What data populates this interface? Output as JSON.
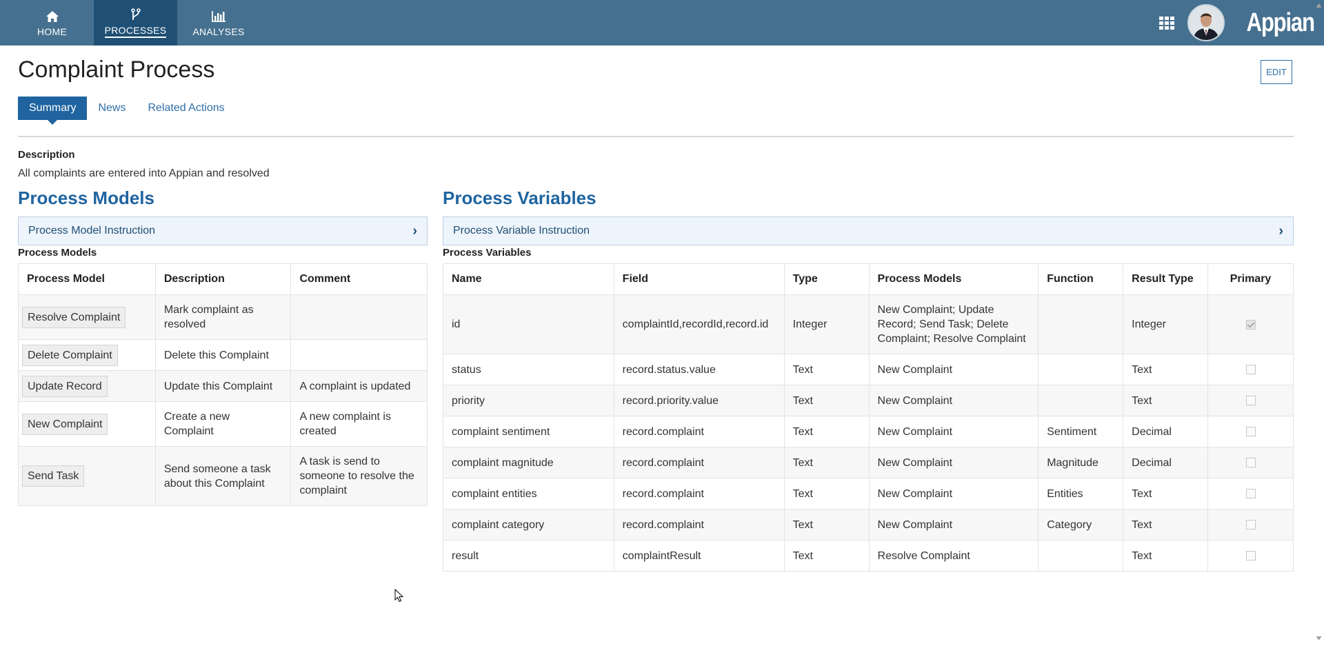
{
  "nav": {
    "home": {
      "label": "HOME",
      "icon": "home-icon"
    },
    "processes": {
      "label": "PROCESSES",
      "icon": "fork-icon"
    },
    "analyses": {
      "label": "ANALYSES",
      "icon": "bar-chart-icon"
    },
    "brand": "Appian"
  },
  "page": {
    "title": "Complaint Process",
    "edit_label": "EDIT",
    "tabs": [
      {
        "label": "Summary",
        "active": true
      },
      {
        "label": "News",
        "active": false
      },
      {
        "label": "Related Actions",
        "active": false
      }
    ],
    "description_label": "Description",
    "description_text": "All complaints are entered into Appian and resolved"
  },
  "process_models": {
    "heading": "Process Models",
    "instruction": "Process Model Instruction",
    "sub_label": "Process Models",
    "columns": [
      "Process Model",
      "Description",
      "Comment"
    ],
    "rows": [
      {
        "name": "Resolve Complaint",
        "description": "Mark complaint as resolved",
        "comment": ""
      },
      {
        "name": "Delete Complaint",
        "description": "Delete this Complaint",
        "comment": ""
      },
      {
        "name": "Update Record",
        "description": "Update this Complaint",
        "comment": "A complaint is updated"
      },
      {
        "name": "New Complaint",
        "description": "Create a new Complaint",
        "comment": "A new complaint is created"
      },
      {
        "name": "Send Task",
        "description": "Send someone a task about this Complaint",
        "comment": "A task is send to someone to resolve the complaint"
      }
    ]
  },
  "process_variables": {
    "heading": "Process Variables",
    "instruction": "Process Variable Instruction",
    "sub_label": "Process Variables",
    "columns": [
      "Name",
      "Field",
      "Type",
      "Process Models",
      "Function",
      "Result Type",
      "Primary"
    ],
    "rows": [
      {
        "name": "id",
        "field": "complaintId,recordId,record.id",
        "type": "Integer",
        "models": "New Complaint; Update Record; Send Task; Delete Complaint; Resolve Complaint",
        "function": "",
        "result_type": "Integer",
        "primary": true
      },
      {
        "name": "status",
        "field": "record.status.value",
        "type": "Text",
        "models": "New Complaint",
        "function": "",
        "result_type": "Text",
        "primary": false
      },
      {
        "name": "priority",
        "field": "record.priority.value",
        "type": "Text",
        "models": "New Complaint",
        "function": "",
        "result_type": "Text",
        "primary": false
      },
      {
        "name": "complaint sentiment",
        "field": "record.complaint",
        "type": "Text",
        "models": "New Complaint",
        "function": "Sentiment",
        "result_type": "Decimal",
        "primary": false
      },
      {
        "name": "complaint magnitude",
        "field": "record.complaint",
        "type": "Text",
        "models": "New Complaint",
        "function": "Magnitude",
        "result_type": "Decimal",
        "primary": false
      },
      {
        "name": "complaint entities",
        "field": "record.complaint",
        "type": "Text",
        "models": "New Complaint",
        "function": "Entities",
        "result_type": "Text",
        "primary": false
      },
      {
        "name": "complaint category",
        "field": "record.complaint",
        "type": "Text",
        "models": "New Complaint",
        "function": "Category",
        "result_type": "Text",
        "primary": false
      },
      {
        "name": "result",
        "field": "complaintResult",
        "type": "Text",
        "models": "Resolve Complaint",
        "function": "",
        "result_type": "Text",
        "primary": false
      }
    ]
  },
  "colors": {
    "topbar": "#46708f",
    "active_nav": "#1f4f74",
    "accent": "#1f64a0"
  }
}
